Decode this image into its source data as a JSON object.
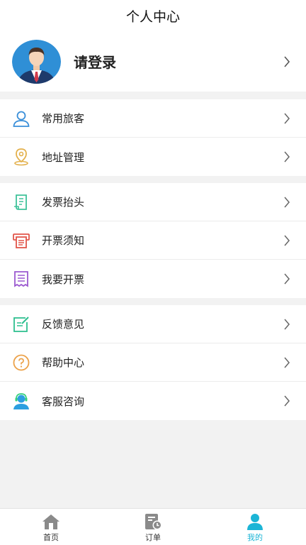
{
  "header": {
    "title": "个人中心"
  },
  "profile": {
    "login_label": "请登录"
  },
  "groups": [
    {
      "items": [
        {
          "label": "常用旅客",
          "icon": "user-icon"
        },
        {
          "label": "地址管理",
          "icon": "location-icon"
        }
      ]
    },
    {
      "items": [
        {
          "label": "发票抬头",
          "icon": "invoice-title-icon"
        },
        {
          "label": "开票须知",
          "icon": "printer-icon"
        },
        {
          "label": "我要开票",
          "icon": "receipt-icon"
        }
      ]
    },
    {
      "items": [
        {
          "label": "反馈意见",
          "icon": "feedback-icon"
        },
        {
          "label": "帮助中心",
          "icon": "help-icon"
        },
        {
          "label": "客服咨询",
          "icon": "customer-service-icon"
        }
      ]
    }
  ],
  "tabbar": {
    "tabs": [
      {
        "label": "首页",
        "icon": "home-icon",
        "active": false
      },
      {
        "label": "订单",
        "icon": "orders-icon",
        "active": false
      },
      {
        "label": "我的",
        "icon": "profile-icon",
        "active": true
      }
    ]
  },
  "colors": {
    "accent": "#1cb5d6",
    "user": "#3a8fd9",
    "location": "#e3b04b",
    "invoice": "#3ec29a",
    "printer": "#e2564a",
    "receipt": "#9b59d0",
    "feedback": "#2dbf8f",
    "help": "#eca24a",
    "service": "#2d9fe0"
  }
}
